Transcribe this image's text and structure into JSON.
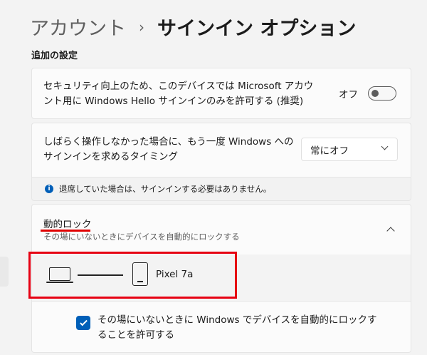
{
  "breadcrumb": {
    "parent": "アカウント",
    "separator": "›",
    "current": "サインイン オプション"
  },
  "section_title": "追加の設定",
  "settings": {
    "hello_only": {
      "text": "セキュリティ向上のため、このデバイスでは Microsoft アカウント用に Windows Hello サインインのみを許可する (推奨)",
      "toggle_label": "オフ",
      "toggle_state": "off"
    },
    "require_signin": {
      "text": "しばらく操作しなかった場合に、もう一度 Windows へのサインインを求めるタイミング",
      "dropdown_value": "常にオフ"
    },
    "info": {
      "icon": "info-icon",
      "text": "退席していた場合は、サインインする必要はありません。"
    },
    "dynamic_lock": {
      "title": "動的ロック",
      "subtitle": "その場にいないときにデバイスを自動的にロックする",
      "expanded": true,
      "device_name": "Pixel 7a",
      "checkbox_label": "その場にいないときに Windows でデバイスを自動的にロックすることを許可する",
      "checkbox_checked": true
    }
  },
  "colors": {
    "accent": "#005fb8",
    "highlight": "#e60012",
    "underline": "#e00000"
  }
}
